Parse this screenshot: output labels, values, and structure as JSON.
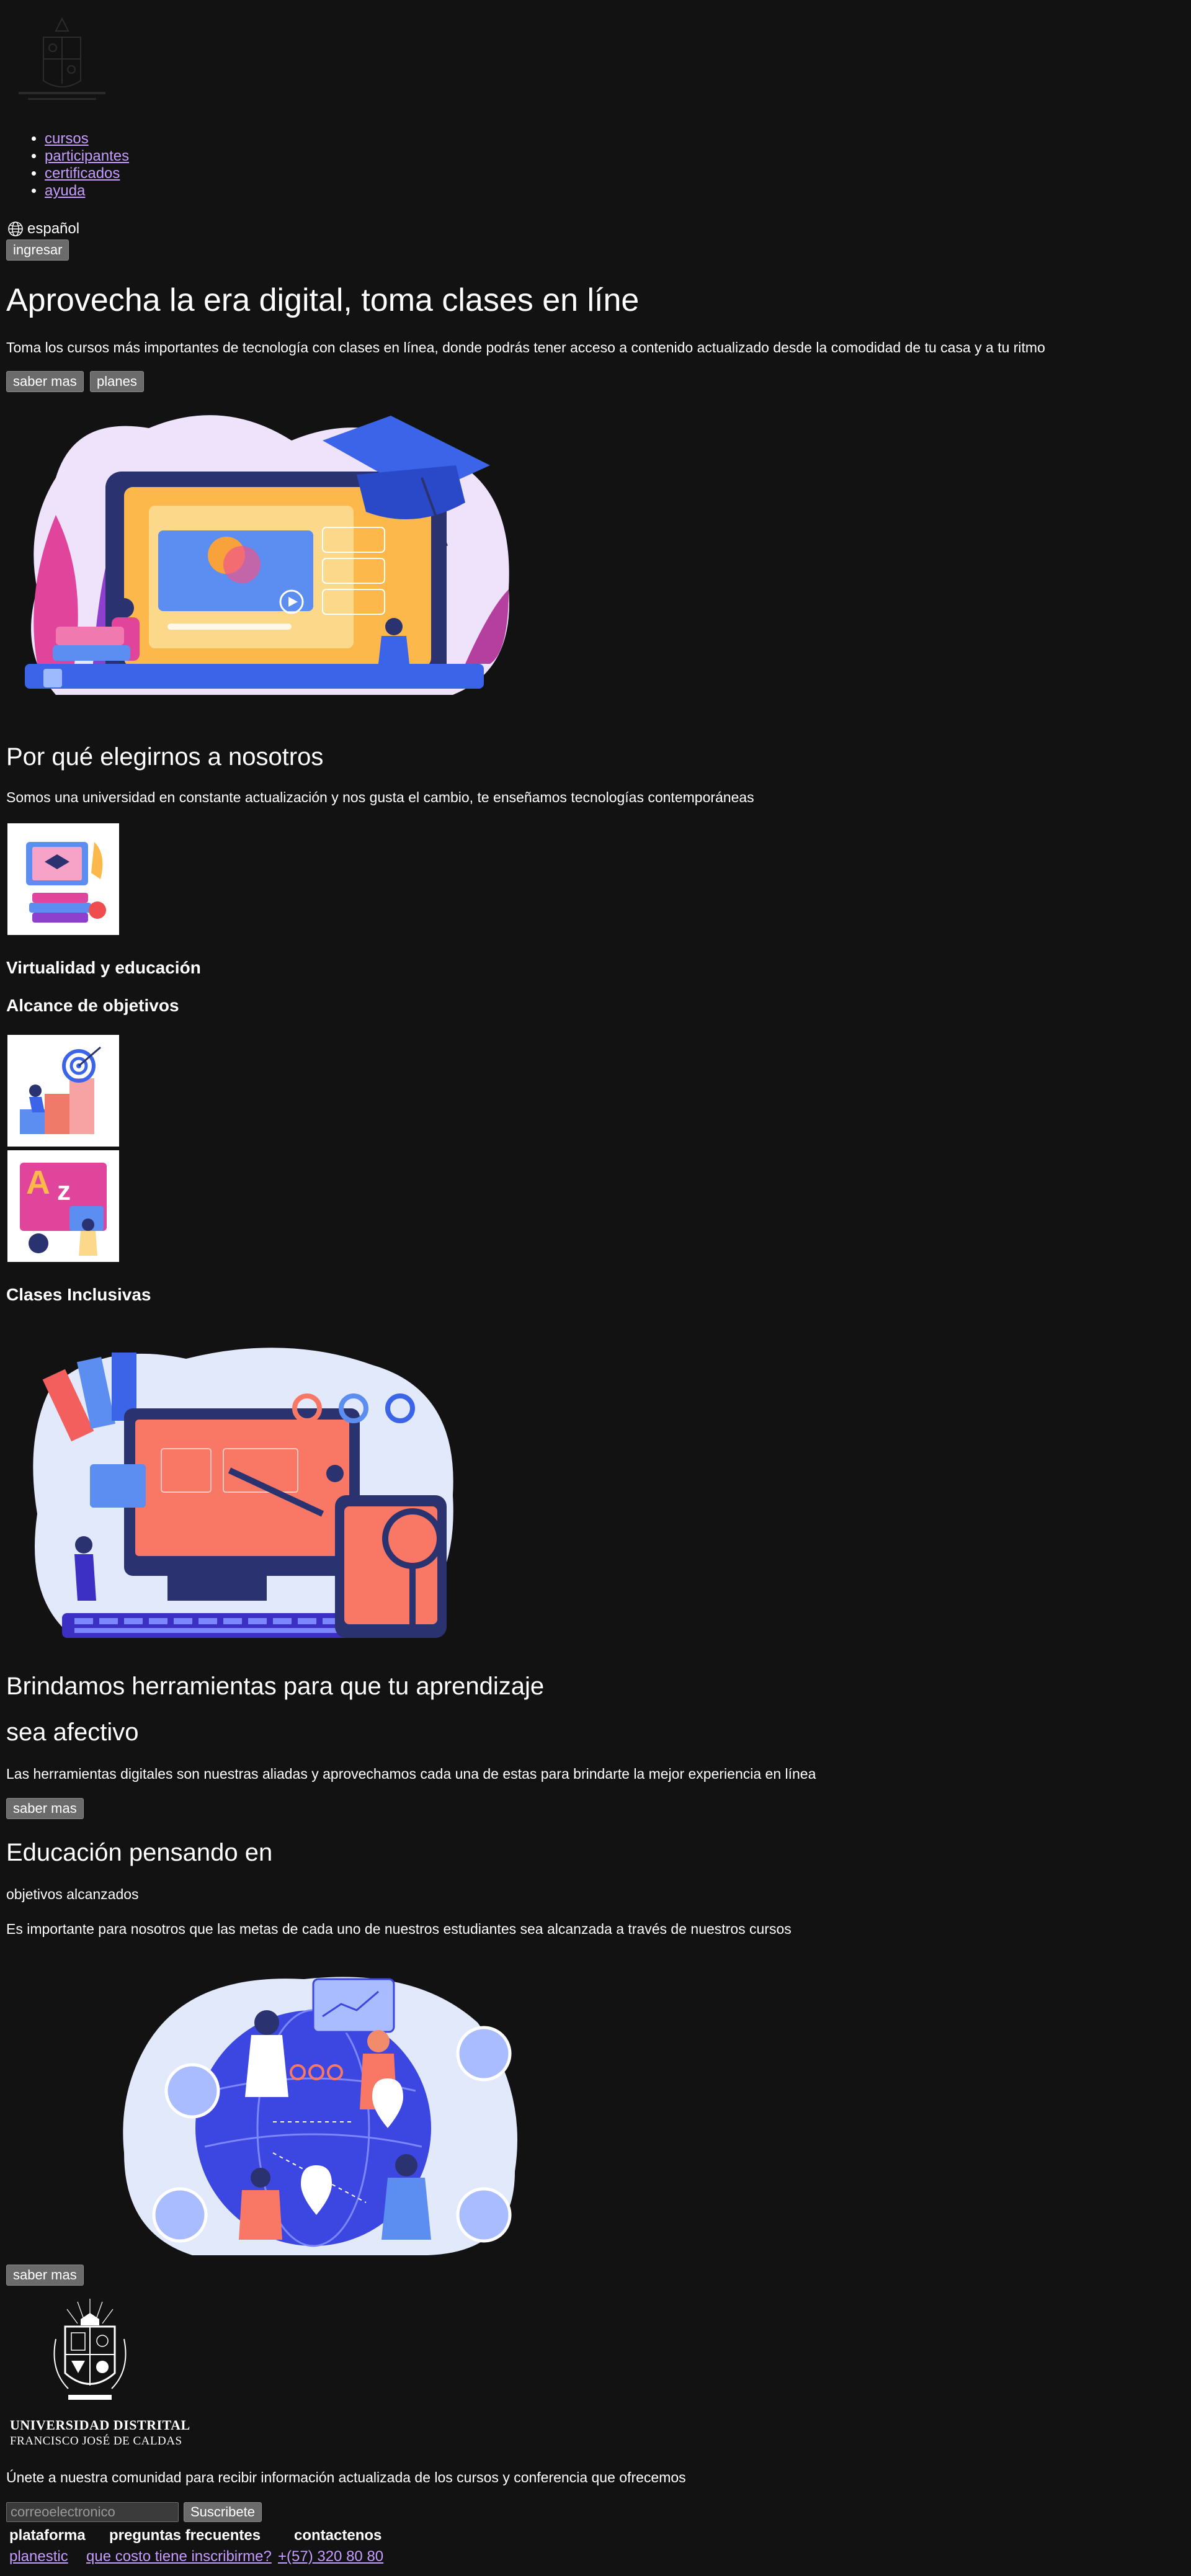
{
  "header": {
    "logo_alt": "Universidad Distrital Francisco José de Caldas",
    "nav": [
      {
        "label": "cursos"
      },
      {
        "label": "participantes"
      },
      {
        "label": "certificados"
      },
      {
        "label": "ayuda"
      }
    ],
    "language": "español",
    "login_button": "ingresar"
  },
  "hero": {
    "title": "Aprovecha la era digital, toma clases en líne",
    "description": "Toma los cursos más importantes de tecnología con clases en línea, donde podrás tener acceso a contenido actualizado desde la comodidad de tu casa y a tu ritmo",
    "more_button": "saber mas",
    "plans_button": "planes"
  },
  "why": {
    "title": "Por qué elegirnos a nosotros",
    "description": "Somos una universidad en constante actualización y nos gusta el cambio, te enseñamos tecnologías contemporáneas",
    "features": [
      {
        "title": "Virtualidad y educación"
      },
      {
        "title": "Alcance de objetivos"
      },
      {
        "title": "Clases Inclusivas"
      }
    ]
  },
  "tools": {
    "title_line1": "Brindamos herramientas para que tu aprendizaje",
    "title_line2": "sea afectivo",
    "description": "Las herramientas digitales son nuestras aliadas y aprovechamos cada una de estas para brindarte la mejor experiencia en línea",
    "more_button": "saber mas"
  },
  "goals": {
    "title": "Educación pensando en",
    "subtitle": "objetivos alcanzados",
    "description": "Es importante para nosotros que las metas de cada uno de nuestros estudiantes sea alcanzada a través de nuestros cursos",
    "more_button": "saber mas"
  },
  "footer": {
    "university_name": "UNIVERSIDAD DISTRITAL",
    "university_subname": "FRANCISCO JOSÉ DE CALDAS",
    "newsletter_text": "Únete a nuestra comunidad para recibir información actualizada de los cursos y conferencia que ofrecemos",
    "email_placeholder": "correoelectronico",
    "subscribe_button": "Suscribete",
    "columns": [
      {
        "heading": "plataforma",
        "link": "planestic"
      },
      {
        "heading": "preguntas frecuentes",
        "link": "que costo tiene inscribirme?"
      },
      {
        "heading": "contactenos",
        "link": "+(57) 320 80 80"
      }
    ]
  },
  "colors": {
    "background": "#121212",
    "link": "#c69cff",
    "button": "#6b6b6b"
  }
}
